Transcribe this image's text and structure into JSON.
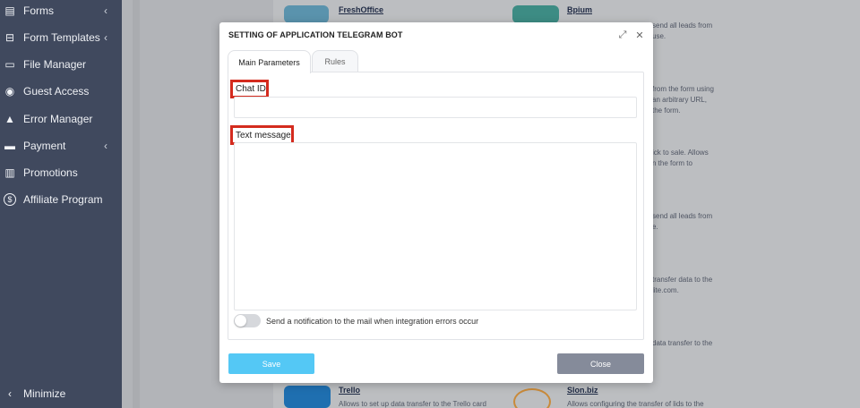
{
  "sidebar": {
    "items": [
      {
        "label": "Forms",
        "icon": "forms-icon",
        "glyph": "▤",
        "has_chevron": true
      },
      {
        "label": "Form Templates",
        "icon": "form-templates-icon",
        "glyph": "⊟",
        "has_chevron": true
      },
      {
        "label": "File Manager",
        "icon": "file-manager-icon",
        "glyph": "▭",
        "has_chevron": false
      },
      {
        "label": "Guest Access",
        "icon": "guest-access-icon",
        "glyph": "◉",
        "has_chevron": false
      },
      {
        "label": "Error Manager",
        "icon": "error-manager-icon",
        "glyph": "▲",
        "has_chevron": false
      },
      {
        "label": "Payment",
        "icon": "payment-icon",
        "glyph": "▬",
        "has_chevron": true
      },
      {
        "label": "Promotions",
        "icon": "promotions-icon",
        "glyph": "▥",
        "has_chevron": false
      },
      {
        "label": "Affiliate Program",
        "icon": "affiliate-program-icon",
        "glyph": "$",
        "has_chevron": false
      }
    ],
    "chevron": "‹",
    "minimize": {
      "label": "Minimize",
      "glyph": "‹"
    }
  },
  "background": {
    "integrations": [
      {
        "title": "FreshOffice",
        "text": ""
      },
      {
        "title": "Bpium",
        "text": ""
      },
      {
        "title": "Trello",
        "text": "Allows to set up data transfer to the Trello card"
      },
      {
        "title": "Slon.biz",
        "text": "Allows configuring the transfer of lids to the"
      }
    ],
    "fragments": [
      "send all leads from",
      "use.",
      "from the form using",
      "an arbitrary URL,",
      "the form.",
      "ick to sale. Allows",
      "n the form to",
      "send all leads from",
      "e.",
      "transfer data to the",
      "lite.com.",
      "data transfer to the"
    ]
  },
  "modal": {
    "title": "SETTING OF APPLICATION TELEGRAM BOT",
    "expand_glyph": "⤢",
    "close_glyph": "✕",
    "tabs": [
      {
        "label": "Main Parameters",
        "active": true
      },
      {
        "label": "Rules",
        "active": false
      }
    ],
    "chat_id": {
      "label": "Chat ID",
      "value": "",
      "placeholder": ""
    },
    "text_message": {
      "label": "Text message",
      "value": "",
      "placeholder": ""
    },
    "notification_toggle": {
      "label": "Send a notification to the mail when integration errors occur",
      "enabled": false
    },
    "save_label": "Save",
    "close_label": "Close"
  },
  "colors": {
    "sidebar_bg": "#40495e",
    "highlight_border": "#d42b1e",
    "save_button": "#54c8f5",
    "close_button": "#858b9a"
  }
}
